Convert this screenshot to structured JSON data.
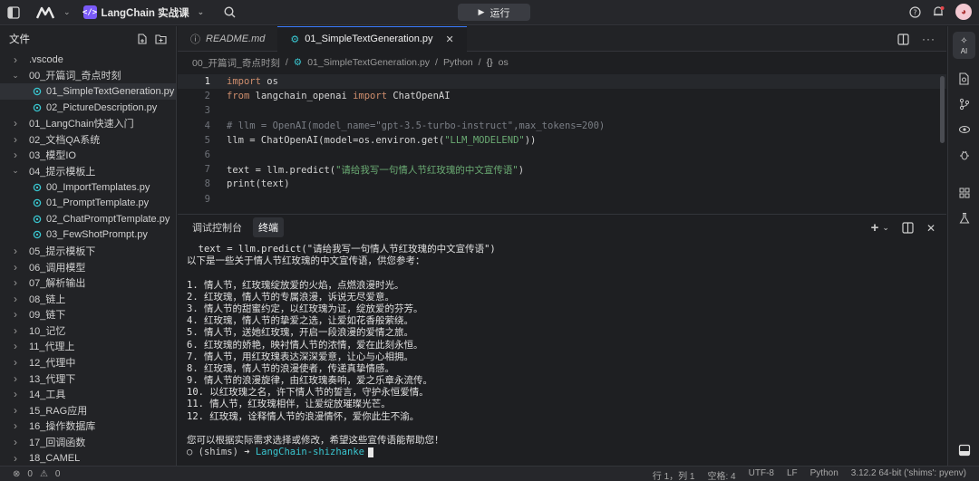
{
  "titlebar": {
    "project_name": "LangChain 实战课",
    "run_label": "运行",
    "project_badge": "</>"
  },
  "sidebar": {
    "title": "文件",
    "items": [
      {
        "label": ".vscode",
        "type": "folder",
        "open": false,
        "indent": 0
      },
      {
        "label": "00_开篇词_奇点时刻",
        "type": "folder",
        "open": true,
        "indent": 0
      },
      {
        "label": "01_SimpleTextGeneration.py",
        "type": "py",
        "indent": 1,
        "selected": true
      },
      {
        "label": "02_PictureDescription.py",
        "type": "py",
        "indent": 1
      },
      {
        "label": "01_LangChain快速入门",
        "type": "folder",
        "open": false,
        "indent": 0
      },
      {
        "label": "02_文档QA系统",
        "type": "folder",
        "open": false,
        "indent": 0
      },
      {
        "label": "03_模型IO",
        "type": "folder",
        "open": false,
        "indent": 0
      },
      {
        "label": "04_提示模板上",
        "type": "folder",
        "open": true,
        "indent": 0
      },
      {
        "label": "00_ImportTemplates.py",
        "type": "py",
        "indent": 1
      },
      {
        "label": "01_PromptTemplate.py",
        "type": "py",
        "indent": 1
      },
      {
        "label": "02_ChatPromptTemplate.py",
        "type": "py",
        "indent": 1
      },
      {
        "label": "03_FewShotPrompt.py",
        "type": "py",
        "indent": 1
      },
      {
        "label": "05_提示模板下",
        "type": "folder",
        "open": false,
        "indent": 0
      },
      {
        "label": "06_调用模型",
        "type": "folder",
        "open": false,
        "indent": 0
      },
      {
        "label": "07_解析输出",
        "type": "folder",
        "open": false,
        "indent": 0
      },
      {
        "label": "08_链上",
        "type": "folder",
        "open": false,
        "indent": 0
      },
      {
        "label": "09_链下",
        "type": "folder",
        "open": false,
        "indent": 0
      },
      {
        "label": "10_记忆",
        "type": "folder",
        "open": false,
        "indent": 0
      },
      {
        "label": "11_代理上",
        "type": "folder",
        "open": false,
        "indent": 0
      },
      {
        "label": "12_代理中",
        "type": "folder",
        "open": false,
        "indent": 0
      },
      {
        "label": "13_代理下",
        "type": "folder",
        "open": false,
        "indent": 0
      },
      {
        "label": "14_工具",
        "type": "folder",
        "open": false,
        "indent": 0
      },
      {
        "label": "15_RAG应用",
        "type": "folder",
        "open": false,
        "indent": 0
      },
      {
        "label": "16_操作数据库",
        "type": "folder",
        "open": false,
        "indent": 0
      },
      {
        "label": "17_回调函数",
        "type": "folder",
        "open": false,
        "indent": 0
      },
      {
        "label": "18_CAMEL",
        "type": "folder",
        "open": false,
        "indent": 0
      }
    ]
  },
  "tabs": [
    {
      "label": "README.md",
      "active": false
    },
    {
      "label": "01_SimpleTextGeneration.py",
      "active": true
    }
  ],
  "breadcrumb": [
    "00_开篇词_奇点时刻",
    "/",
    "01_SimpleTextGeneration.py",
    "/",
    "Python",
    "/",
    "os"
  ],
  "breadcrumb_symbol": "{}",
  "editor": {
    "lines": [
      {
        "n": "1",
        "tokens": [
          {
            "t": "import",
            "c": "kw"
          },
          {
            "t": " os"
          }
        ],
        "current": true
      },
      {
        "n": "2",
        "tokens": [
          {
            "t": "from",
            "c": "kw"
          },
          {
            "t": " langchain_openai "
          },
          {
            "t": "import",
            "c": "kw"
          },
          {
            "t": " ChatOpenAI"
          }
        ]
      },
      {
        "n": "3",
        "tokens": []
      },
      {
        "n": "4",
        "tokens": [
          {
            "t": "# llm = OpenAI(model_name=\"gpt-3.5-turbo-instruct\",max_tokens=200)",
            "c": "cm"
          }
        ]
      },
      {
        "n": "5",
        "tokens": [
          {
            "t": "llm = ChatOpenAI(model=os.environ.get("
          },
          {
            "t": "\"LLM_MODELEND\"",
            "c": "st"
          },
          {
            "t": "))"
          }
        ]
      },
      {
        "n": "6",
        "tokens": []
      },
      {
        "n": "7",
        "tokens": [
          {
            "t": "text = llm.predict("
          },
          {
            "t": "\"请给我写一句情人节红玫瑰的中文宣传语\"",
            "c": "st"
          },
          {
            "t": ")"
          }
        ]
      },
      {
        "n": "8",
        "tokens": [
          {
            "t": "print(text)"
          }
        ]
      },
      {
        "n": "9",
        "tokens": []
      }
    ]
  },
  "panel": {
    "tabs": [
      {
        "label": "调试控制台",
        "active": false
      },
      {
        "label": "终端",
        "active": true
      }
    ],
    "terminal_lines": [
      "  text = llm.predict(\"请给我写一句情人节红玫瑰的中文宣传语\")",
      "以下是一些关于情人节红玫瑰的中文宣传语，供您参考：",
      "",
      "1. 情人节，红玫瑰绽放爱的火焰，点燃浪漫时光。",
      "2. 红玫瑰，情人节的专属浪漫，诉说无尽爱意。",
      "3. 情人节的甜蜜约定，以红玫瑰为证，绽放爱的芬芳。",
      "4. 红玫瑰，情人节的挚爱之选，让爱如花香般萦绕。",
      "5. 情人节，送她红玫瑰，开启一段浪漫的爱情之旅。",
      "6. 红玫瑰的娇艳，映衬情人节的浓情，爱在此刻永恒。",
      "7. 情人节，用红玫瑰表达深深爱意，让心与心相拥。",
      "8. 红玫瑰，情人节的浪漫使者，传递真挚情感。",
      "9. 情人节的浪漫旋律，由红玫瑰奏响，爱之乐章永流传。",
      "10. 以红玫瑰之名，许下情人节的誓言，守护永恒爱情。",
      "11. 情人节，红玫瑰相伴，让爱绽放璀璨光芒。",
      "12. 红玫瑰，诠释情人节的浪漫情怀，爱你此生不渝。",
      "",
      "您可以根据实际需求选择或修改，希望这些宣传语能帮助您！"
    ],
    "prompt_env": "○ (shims) ➜ ",
    "prompt_dir": "LangChain-shizhanke"
  },
  "rightbar": {
    "ai_label": "AI"
  },
  "statusbar": {
    "errors": "0",
    "warnings": "0",
    "position": "行 1，列 1",
    "spaces": "空格: 4",
    "encoding": "UTF-8",
    "eol": "LF",
    "language": "Python",
    "interpreter": "3.12.2 64-bit ('shims': pyenv)"
  },
  "colors": {
    "keyword": "#cf8e6d",
    "string": "#6aab73",
    "comment": "#7a7e85",
    "python_icon": "#39c5cf",
    "accent": "#3b7cff"
  }
}
